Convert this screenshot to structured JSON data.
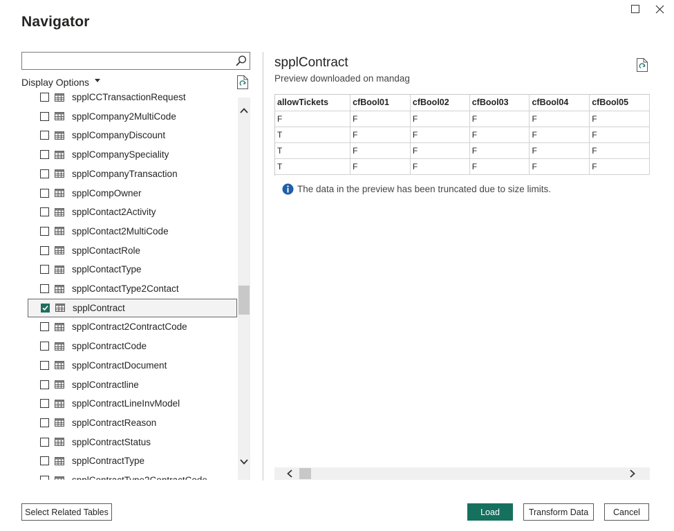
{
  "window": {
    "title": "Navigator"
  },
  "search": {
    "value": "",
    "placeholder": ""
  },
  "display_options": {
    "label": "Display Options"
  },
  "tree_items": [
    {
      "label": "spplCCTransactionRequest",
      "checked": false
    },
    {
      "label": "spplCompany2MultiCode",
      "checked": false
    },
    {
      "label": "spplCompanyDiscount",
      "checked": false
    },
    {
      "label": "spplCompanySpeciality",
      "checked": false
    },
    {
      "label": "spplCompanyTransaction",
      "checked": false
    },
    {
      "label": "spplCompOwner",
      "checked": false
    },
    {
      "label": "spplContact2Activity",
      "checked": false
    },
    {
      "label": "spplContact2MultiCode",
      "checked": false
    },
    {
      "label": "spplContactRole",
      "checked": false
    },
    {
      "label": "spplContactType",
      "checked": false
    },
    {
      "label": "spplContactType2Contact",
      "checked": false
    },
    {
      "label": "spplContract",
      "checked": true,
      "selected": true
    },
    {
      "label": "spplContract2ContractCode",
      "checked": false
    },
    {
      "label": "spplContractCode",
      "checked": false
    },
    {
      "label": "spplContractDocument",
      "checked": false
    },
    {
      "label": "spplContractline",
      "checked": false
    },
    {
      "label": "spplContractLineInvModel",
      "checked": false
    },
    {
      "label": "spplContractReason",
      "checked": false
    },
    {
      "label": "spplContractStatus",
      "checked": false
    },
    {
      "label": "spplContractType",
      "checked": false
    },
    {
      "label": "spplContractType2ContractCode",
      "checked": false
    }
  ],
  "preview": {
    "title": "spplContract",
    "subtitle": "Preview downloaded on mandag",
    "columns": [
      "allowTickets",
      "cfBool01",
      "cfBool02",
      "cfBool03",
      "cfBool04",
      "cfBool05"
    ],
    "rows": [
      [
        "F",
        "F",
        "F",
        "F",
        "F",
        "F"
      ],
      [
        "T",
        "F",
        "F",
        "F",
        "F",
        "F"
      ],
      [
        "T",
        "F",
        "F",
        "F",
        "F",
        "F"
      ],
      [
        "T",
        "F",
        "F",
        "F",
        "F",
        "F"
      ]
    ],
    "notice": "The data in the preview has been truncated due to size limits."
  },
  "buttons": {
    "select_related": "Select Related Tables",
    "load": "Load",
    "transform": "Transform Data",
    "cancel": "Cancel"
  },
  "colors": {
    "accent": "#16705e",
    "info": "#1f5fa8"
  }
}
